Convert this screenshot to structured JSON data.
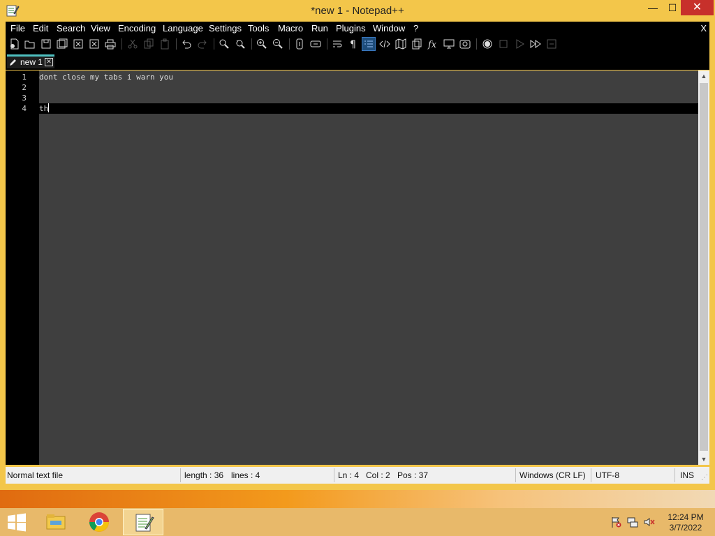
{
  "window": {
    "title": "*new 1 - Notepad++",
    "minimize": "—",
    "maximize": "☐",
    "close": "✕"
  },
  "menu": {
    "items": [
      "File",
      "Edit",
      "Search",
      "View",
      "Encoding",
      "Language",
      "Settings",
      "Tools",
      "Macro",
      "Run",
      "Plugins",
      "Window",
      "?"
    ],
    "close_doc": "X"
  },
  "toolbar": {
    "buttons": [
      "new-file",
      "open-file",
      "save",
      "save-all",
      "close",
      "close-all",
      "print",
      "cut",
      "copy",
      "paste",
      "undo",
      "redo",
      "find",
      "replace",
      "zoom-in",
      "zoom-out",
      "sync-vertical",
      "sync-horizontal",
      "word-wrap",
      "show-all-characters",
      "indent-guide",
      "user-defined-language",
      "document-map",
      "document-list",
      "function-list",
      "folder-as-workspace",
      "monitoring",
      "record-macro",
      "stop-recording",
      "playback-macro",
      "run-macro-multiple",
      "save-macro"
    ]
  },
  "tabs": [
    {
      "label": "new 1",
      "icon": "pencil-icon",
      "modified": true
    }
  ],
  "editor": {
    "lines": [
      {
        "num": "1",
        "text": "dont close my tabs i warn you"
      },
      {
        "num": "2",
        "text": ""
      },
      {
        "num": "3",
        "text": ""
      },
      {
        "num": "4",
        "text": "th"
      }
    ],
    "current_line": 4
  },
  "status": {
    "file_type": "Normal text file",
    "length": "length : 36",
    "lines": "lines : 4",
    "ln": "Ln : 4",
    "col": "Col : 2",
    "pos": "Pos : 37",
    "eol": "Windows (CR LF)",
    "encoding": "UTF-8",
    "mode": "INS"
  },
  "taskbar": {
    "apps": [
      "start-button",
      "file-explorer",
      "chrome",
      "notepad-plus-plus"
    ],
    "active_app": "notepad-plus-plus",
    "clock_time": "12:24 PM",
    "clock_date": "3/7/2022"
  },
  "colors": {
    "window_frame": "#f3c64a",
    "editor_bg": "#3f3f3f",
    "gutter_bg": "#000000",
    "close_button": "#c7302b",
    "tab_accent": "#4ec0c0"
  }
}
